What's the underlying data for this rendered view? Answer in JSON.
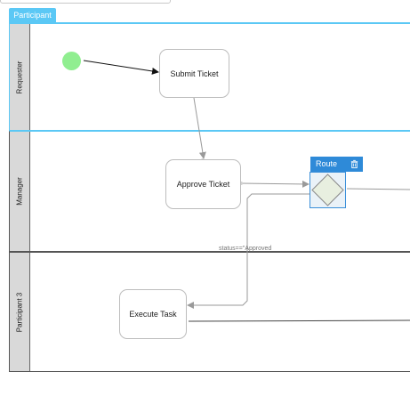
{
  "pool": {
    "tab_label": "Participant"
  },
  "lanes": [
    {
      "label": "Requester"
    },
    {
      "label": "Manager"
    },
    {
      "label": "Participant 3"
    }
  ],
  "tasks": {
    "submit": "Submit Ticket",
    "approve": "Approve Ticket",
    "execute": "Execute Task"
  },
  "gateway": {
    "toolbar_label": "Route",
    "delete_icon": "trash-icon"
  },
  "edges": {
    "condition_label": "status==\"Approved"
  },
  "colors": {
    "pool_tab": "#5bc8f5",
    "start_event": "#90ee90",
    "selection": "#2e8ad8",
    "gateway_fill": "#eaf2f8"
  }
}
